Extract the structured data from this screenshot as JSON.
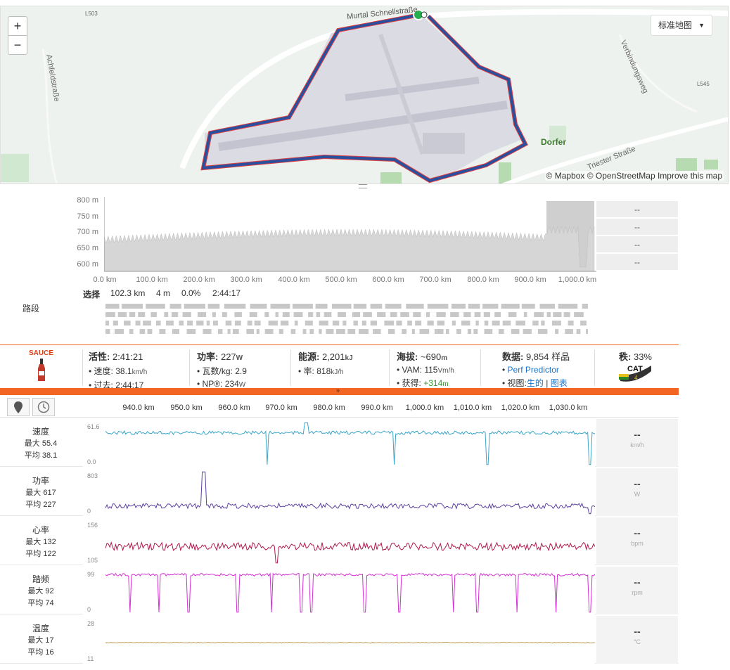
{
  "map": {
    "zoom_in": "+",
    "zoom_out": "−",
    "style_selector": "标准地图",
    "attribution": "© Mapbox © OpenStreetMap Improve this map",
    "labels": {
      "road_top": "Murtal Schnellstraße",
      "road_left": "Achfeldstraße",
      "road_right": "Verbindungsweg",
      "road_bottom": "Triester Straße",
      "town": "Dorfer",
      "l503": "L503",
      "l545": "L545"
    }
  },
  "elevation": {
    "y_ticks": [
      "800 m",
      "750 m",
      "700 m",
      "650 m",
      "600 m"
    ],
    "x_ticks": [
      "0.0 km",
      "100.0 km",
      "200.0 km",
      "300.0 km",
      "400.0 km",
      "500.0 km",
      "600.0 km",
      "700.0 km",
      "800.0 km",
      "900.0 km",
      "1,000.0 km"
    ],
    "side_values": [
      "--",
      "--",
      "--",
      "--"
    ],
    "selection": {
      "label": "选择",
      "distance": "102.3 km",
      "elev": "4 m",
      "grade": "0.0%",
      "time": "2:44:17"
    },
    "segments_label": "路段"
  },
  "stats": {
    "sauce": "SAUCE",
    "active": {
      "label": "活性:",
      "value": "2:41:21",
      "rows": [
        [
          "速度:",
          "38.1",
          "km/h"
        ],
        [
          "过去:",
          "2:44:17",
          ""
        ]
      ]
    },
    "power": {
      "label": "功率:",
      "value": "227",
      "unit": "W",
      "rows": [
        [
          "瓦数/kg:",
          "2.9",
          ""
        ],
        [
          "NP®:",
          "234",
          "W"
        ]
      ]
    },
    "energy": {
      "label": "能源:",
      "value": "2,201",
      "unit": "kJ",
      "rows": [
        [
          "率:",
          "818",
          "kJ/h"
        ]
      ]
    },
    "elevation": {
      "label": "海拔:",
      "value": "~690",
      "unit": "m",
      "rows": [
        [
          "VAM:",
          "115",
          "Vm/h"
        ],
        [
          "获得:",
          "+314",
          "m"
        ]
      ]
    },
    "data": {
      "label": "数据:",
      "value": "9,854 样品",
      "perf_predictor": "Perf Predictor",
      "view_label": "视图:",
      "view_raw": "生的",
      "view_sep": " | ",
      "view_chart": "图表"
    },
    "rank": {
      "label": "秩:",
      "value": "33%",
      "badge": "CAT",
      "badge_num": "4"
    }
  },
  "analysis": {
    "x_ticks": [
      "940.0 km",
      "950.0 km",
      "960.0 km",
      "970.0 km",
      "980.0 km",
      "990.0 km",
      "1,000.0 km",
      "1,010.0 km",
      "1,020.0 km",
      "1,030.0 km"
    ],
    "metrics": [
      {
        "name": "速度",
        "max": "最大 55.4",
        "avg": "平均 38.1",
        "top": "61.6",
        "bottom": "0.0",
        "side": "--",
        "unit": "km/h",
        "color": "#3aa6c8"
      },
      {
        "name": "功率",
        "max": "最大 617",
        "avg": "平均 227",
        "top": "803",
        "bottom": "0",
        "side": "--",
        "unit": "W",
        "color": "#5b3fa0"
      },
      {
        "name": "心率",
        "max": "最大 132",
        "avg": "平均 122",
        "top": "156",
        "bottom": "105",
        "side": "--",
        "unit": "bpm",
        "color": "#b0174c"
      },
      {
        "name": "踏频",
        "max": "最大 92",
        "avg": "平均 74",
        "top": "99",
        "bottom": "0",
        "side": "--",
        "unit": "rpm",
        "color": "#d42ed4"
      },
      {
        "name": "温度",
        "max": "最大 17",
        "avg": "平均 16",
        "top": "28",
        "bottom": "11",
        "side": "--",
        "unit": "°C",
        "color": "#b89a4a"
      }
    ]
  }
}
